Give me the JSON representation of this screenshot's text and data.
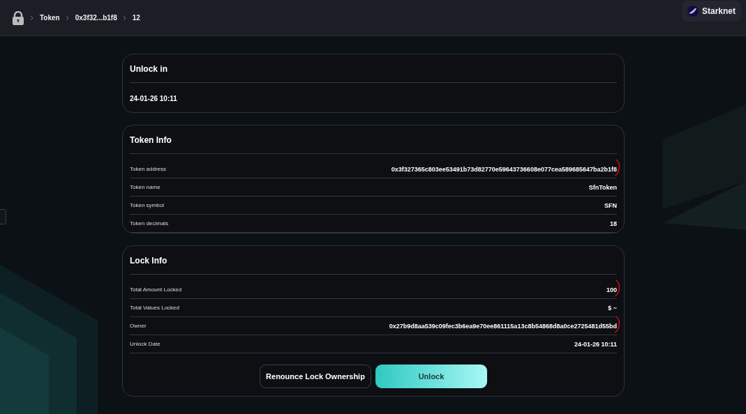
{
  "breadcrumbs": [
    "Token",
    "0x3f32...b1f8",
    "12"
  ],
  "network": {
    "label": "Starknet"
  },
  "unlock_card": {
    "title": "Unlock in",
    "value": "24-01-26 10:11"
  },
  "token_info": {
    "title": "Token Info",
    "rows": [
      {
        "label": "Token address",
        "value": "0x3f327365c803ee53491b73d82770e59643736608e077cea589685647ba2b1f8",
        "marked": true
      },
      {
        "label": "Token name",
        "value": "SfnToken",
        "marked": false
      },
      {
        "label": "Token symbol",
        "value": "SFN",
        "marked": false
      },
      {
        "label": "Token decimals",
        "value": "18",
        "marked": false
      }
    ]
  },
  "lock_info": {
    "title": "Lock Info",
    "rows": [
      {
        "label": "Total Amount Locked",
        "value": "100",
        "marked": true
      },
      {
        "label": "Total Values Locked",
        "value": "$ ~",
        "marked": false
      },
      {
        "label": "Owner",
        "value": "0x27b9d8aa539c09fec3b6ea9e70ee861115a13c8b54868d8a0ce2725481d55bd",
        "marked": true
      },
      {
        "label": "Unlock Date",
        "value": "24-01-26 10:11",
        "marked": false
      }
    ]
  },
  "buttons": [
    {
      "label": "Renounce Lock Ownership",
      "kind": "outline"
    },
    {
      "label": "Unlock",
      "kind": "primary"
    }
  ]
}
